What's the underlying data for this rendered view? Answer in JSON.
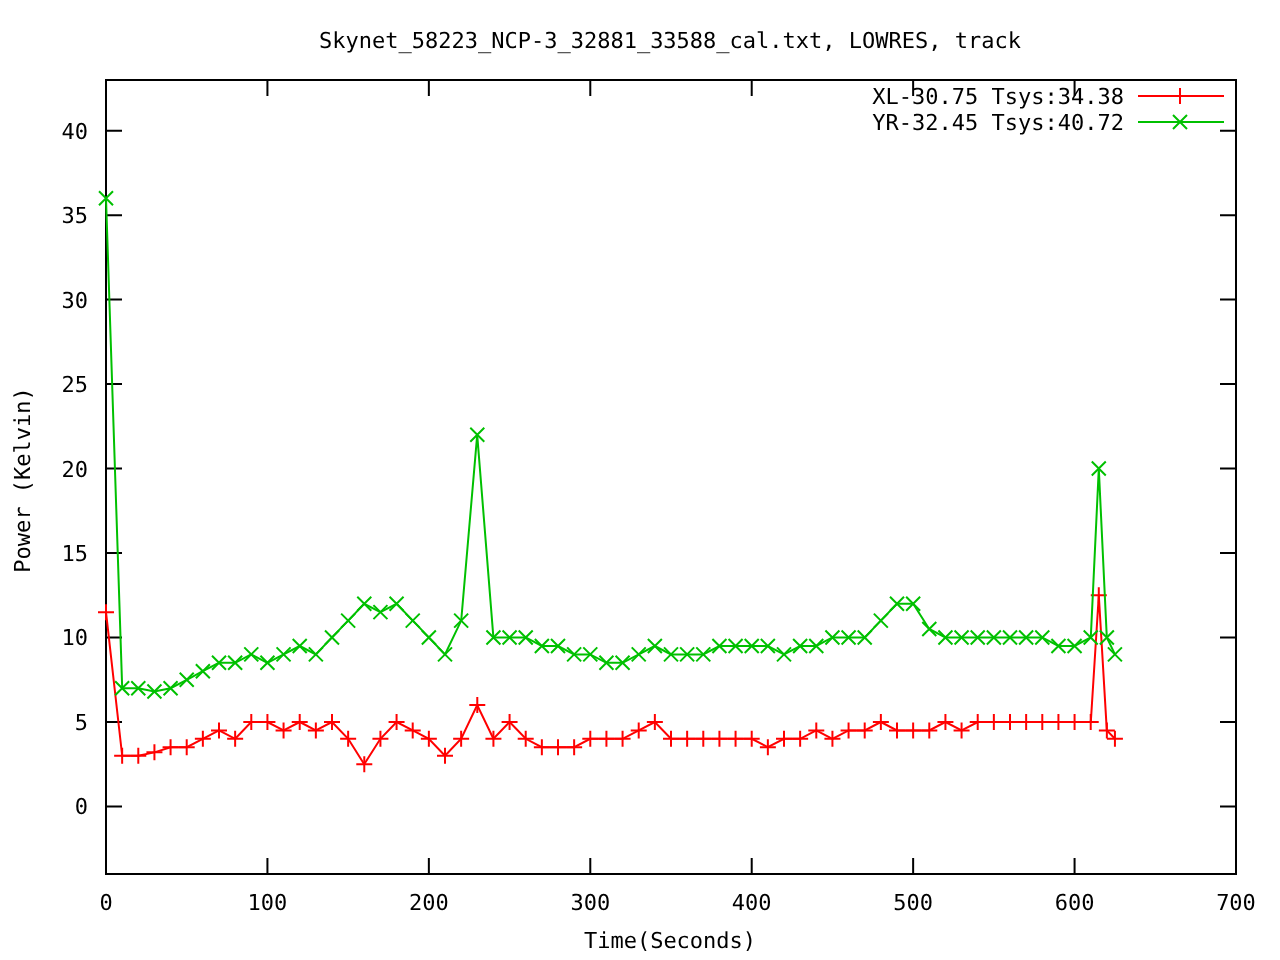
{
  "chart_data": {
    "type": "line",
    "title": "Skynet_58223_NCP-3_32881_33588_cal.txt, LOWRES, track",
    "xlabel": "Time(Seconds)",
    "ylabel": "Power (Kelvin)",
    "x": [
      0,
      10,
      20,
      30,
      40,
      50,
      60,
      70,
      80,
      90,
      100,
      110,
      120,
      130,
      140,
      150,
      160,
      170,
      180,
      190,
      200,
      210,
      220,
      230,
      240,
      250,
      260,
      270,
      280,
      290,
      300,
      310,
      320,
      330,
      340,
      350,
      360,
      370,
      380,
      390,
      400,
      410,
      420,
      430,
      440,
      450,
      460,
      470,
      480,
      490,
      500,
      510,
      520,
      530,
      540,
      550,
      560,
      570,
      580,
      590,
      600,
      610,
      615,
      620,
      625
    ],
    "series": [
      {
        "name": "XL-30.75 Tsys:34.38",
        "color": "#ff0000",
        "marker": "plus",
        "values": [
          11.5,
          3,
          3,
          3.2,
          3.5,
          3.5,
          4,
          4.5,
          4,
          5,
          5,
          4.5,
          5,
          4.5,
          5,
          4,
          2.5,
          4,
          5,
          4.5,
          4,
          3,
          4,
          6,
          4,
          5,
          4,
          3.5,
          3.5,
          3.5,
          4,
          4,
          4,
          4.5,
          5,
          4,
          4,
          4,
          4,
          4,
          4,
          3.5,
          4,
          4,
          4.5,
          4,
          4.5,
          4.5,
          5,
          4.5,
          4.5,
          4.5,
          5,
          4.5,
          5,
          5,
          5,
          5,
          5,
          5,
          5,
          5,
          12.5,
          4.5,
          4
        ]
      },
      {
        "name": "YR-32.45 Tsys:40.72",
        "color": "#00c000",
        "marker": "cross",
        "values": [
          36,
          7,
          7,
          6.8,
          7,
          7.5,
          8,
          8.5,
          8.5,
          9,
          8.5,
          9,
          9.5,
          9,
          10,
          11,
          12,
          11.5,
          12,
          11,
          10,
          9,
          11,
          22,
          10,
          10,
          10,
          9.5,
          9.5,
          9,
          9,
          8.5,
          8.5,
          9,
          9.5,
          9,
          9,
          9,
          9.5,
          9.5,
          9.5,
          9.5,
          9,
          9.5,
          9.5,
          10,
          10,
          10,
          11,
          12,
          12,
          10.5,
          10,
          10,
          10,
          10,
          10,
          10,
          10,
          9.5,
          9.5,
          10,
          20,
          10,
          9
        ]
      }
    ],
    "legend": true,
    "xlim": [
      0,
      700
    ],
    "ylim": [
      -4,
      43
    ],
    "xticks": [
      0,
      100,
      200,
      300,
      400,
      500,
      600,
      700
    ],
    "yticks": [
      0,
      5,
      10,
      15,
      20,
      25,
      30,
      35,
      40
    ]
  }
}
